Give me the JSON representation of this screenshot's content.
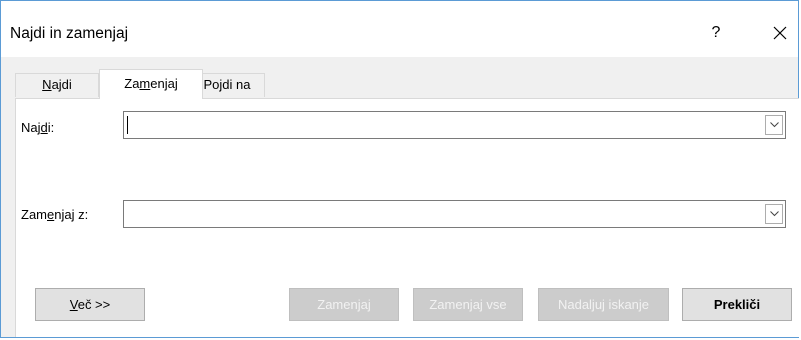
{
  "window": {
    "title": "Najdi in zamenjaj",
    "help_label": "?"
  },
  "tabs": [
    {
      "label_pre": "",
      "label_u": "N",
      "label_post": "ajdi",
      "active": false
    },
    {
      "label_pre": "Za",
      "label_u": "m",
      "label_post": "enjaj",
      "active": true
    },
    {
      "label_pre": "Pojdi na",
      "label_u": "",
      "label_post": "",
      "active": false
    }
  ],
  "find": {
    "label_pre": "Naj",
    "label_u": "d",
    "label_post": "i:",
    "value": ""
  },
  "replace": {
    "label_pre": "Zam",
    "label_u": "e",
    "label_post": "njaj z:",
    "value": ""
  },
  "buttons": {
    "more_u": "V",
    "more_rest": "eč >>",
    "replace": "Zamenjaj",
    "replace_all": "Zamenjaj vse",
    "find_next": "Nadaljuj iskanje",
    "cancel": "Prekliči"
  },
  "colors": {
    "window_border": "#5b9bd5",
    "disabled_button": "#cccccc",
    "dialog_background": "#f0f0f0"
  }
}
